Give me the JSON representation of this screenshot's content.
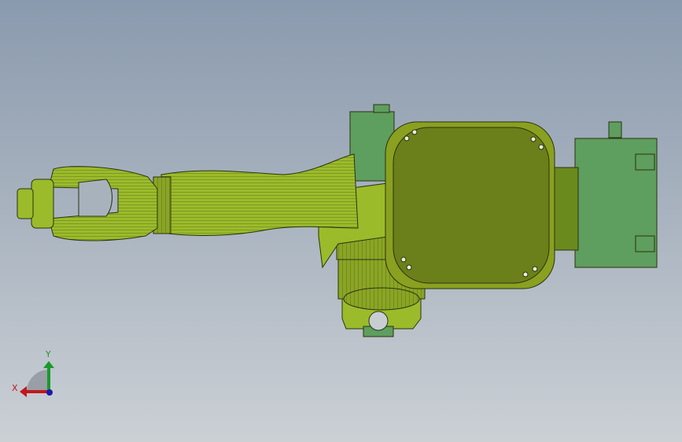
{
  "viewport": {
    "model": "robot-arm-assembly",
    "colors": {
      "body_light": "#9bbb2a",
      "body_dark": "#6b7f1a",
      "motor": "#5e9e5e",
      "edge": "#2a3310"
    }
  },
  "triad": {
    "x_label": "X",
    "y_label": "Y",
    "x_color": "#c0181c",
    "y_color": "#1a9a2a",
    "z_color": "#1a1aa8"
  }
}
